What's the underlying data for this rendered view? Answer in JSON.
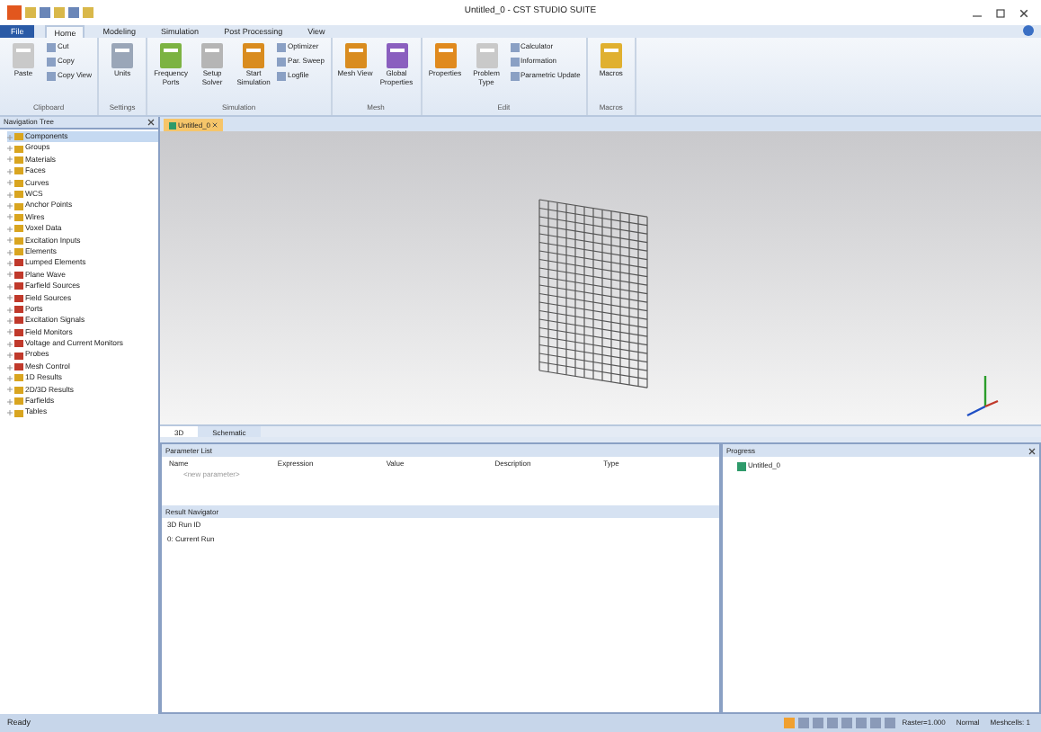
{
  "window": {
    "title": "Untitled_0 - CST STUDIO SUITE"
  },
  "ribbon_tabs": [
    {
      "label": "File",
      "selected": false,
      "kind": "file"
    },
    {
      "label": "Home",
      "selected": true,
      "kind": "tab"
    },
    {
      "label": "Modeling",
      "selected": false,
      "kind": "tab"
    },
    {
      "label": "Simulation",
      "selected": false,
      "kind": "tab"
    },
    {
      "label": "Post Processing",
      "selected": false,
      "kind": "tab"
    },
    {
      "label": "View",
      "selected": false,
      "kind": "tab"
    }
  ],
  "ribbon_groups": [
    {
      "label": "Clipboard",
      "large": [
        "Paste"
      ],
      "small": [
        "Cut",
        "Copy",
        "Copy View"
      ]
    },
    {
      "label": "Settings",
      "large": [
        "Units"
      ]
    },
    {
      "label": "Simulation",
      "large": [
        "Frequency Ports",
        "Setup Solver",
        "Start Simulation"
      ],
      "small": [
        "Optimizer",
        "Par. Sweep",
        "Logfile"
      ]
    },
    {
      "label": "Mesh",
      "large": [
        "Mesh View",
        "Global Properties"
      ]
    },
    {
      "label": "Edit",
      "large": [
        "Properties",
        "Problem Type"
      ],
      "small": [
        "Calculator",
        "Information",
        "Parametric Update"
      ]
    },
    {
      "label": "Macros",
      "large": [
        "Macros"
      ]
    }
  ],
  "navigation_tree": {
    "title": "Navigation Tree",
    "items": [
      {
        "label": "Components",
        "color": "#d9a520",
        "selected": true
      },
      {
        "label": "Groups",
        "color": "#d9a520",
        "selected": false
      },
      {
        "label": "Materials",
        "color": "#d9a520",
        "selected": false
      },
      {
        "label": "Faces",
        "color": "#d9a520",
        "selected": false
      },
      {
        "label": "Curves",
        "color": "#d9a520",
        "selected": false
      },
      {
        "label": "WCS",
        "color": "#d9a520",
        "selected": false
      },
      {
        "label": "Anchor Points",
        "color": "#d9a520",
        "selected": false
      },
      {
        "label": "Wires",
        "color": "#d9a520",
        "selected": false
      },
      {
        "label": "Voxel Data",
        "color": "#d9a520",
        "selected": false
      },
      {
        "label": "Excitation Inputs",
        "color": "#d9a520",
        "selected": false
      },
      {
        "label": "Elements",
        "color": "#d9a520",
        "selected": false
      },
      {
        "label": "Lumped Elements",
        "color": "#c0392b",
        "selected": false
      },
      {
        "label": "Plane Wave",
        "color": "#c0392b",
        "selected": false
      },
      {
        "label": "Farfield Sources",
        "color": "#c0392b",
        "selected": false
      },
      {
        "label": "Field Sources",
        "color": "#c0392b",
        "selected": false
      },
      {
        "label": "Ports",
        "color": "#c0392b",
        "selected": false
      },
      {
        "label": "Excitation Signals",
        "color": "#c0392b",
        "selected": false
      },
      {
        "label": "Field Monitors",
        "color": "#c0392b",
        "selected": false
      },
      {
        "label": "Voltage and Current Monitors",
        "color": "#c0392b",
        "selected": false
      },
      {
        "label": "Probes",
        "color": "#c0392b",
        "selected": false
      },
      {
        "label": "Mesh Control",
        "color": "#c0392b",
        "selected": false
      },
      {
        "label": "1D Results",
        "color": "#d9a520",
        "selected": false
      },
      {
        "label": "2D/3D Results",
        "color": "#d9a520",
        "selected": false
      },
      {
        "label": "Farfields",
        "color": "#d9a520",
        "selected": false
      },
      {
        "label": "Tables",
        "color": "#d9a520",
        "selected": false
      }
    ]
  },
  "document_tab": {
    "label": "Untitled_0"
  },
  "view_tabs": [
    {
      "label": "3D",
      "selected": true
    },
    {
      "label": "Schematic",
      "selected": false
    }
  ],
  "parameter_list": {
    "title": "Parameter List",
    "columns": [
      "Name",
      "Expression",
      "Value",
      "Description",
      "Type"
    ],
    "placeholder": "<new parameter>"
  },
  "result_navigator": {
    "title": "Result Navigator",
    "rows": [
      "3D Run ID",
      "0: Current Run"
    ]
  },
  "messages": {
    "title": "Progress",
    "items": [
      "Untitled_0"
    ]
  },
  "status_bar": {
    "left": "Ready",
    "right": [
      "Raster=1.000",
      "Normal",
      "Meshcells: 1"
    ]
  }
}
